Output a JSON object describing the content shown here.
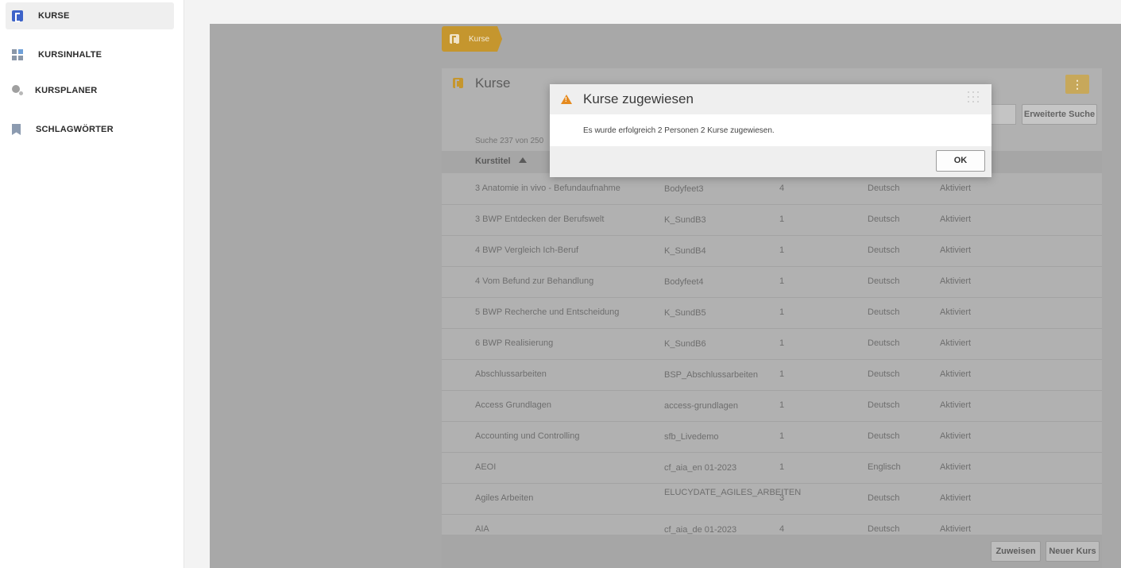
{
  "sidebar": {
    "items": [
      {
        "label": "KURSE",
        "icon": "kurse-icon",
        "active": true
      },
      {
        "label": "KURSINHALTE",
        "icon": "kursinhalte-icon"
      },
      {
        "label": "KURSPLANER",
        "icon": "kursplaner-icon"
      },
      {
        "label": "SCHLAGWÖRTER",
        "icon": "bookmark-icon"
      }
    ]
  },
  "breadcrumb": {
    "label": "Kurse"
  },
  "panel": {
    "title": "Kurse",
    "advanced_search_label": "Erweiterte Suche",
    "result_count": "Suche 237 von 250",
    "column_header": "Kurstitel"
  },
  "table": {
    "rows": [
      [
        "3 Anatomie in vivo - Befundaufnahme",
        "Bodyfeet3",
        "4",
        "Deutsch",
        "Aktiviert"
      ],
      [
        "3 BWP Entdecken der Berufswelt",
        "K_SundB3",
        "1",
        "Deutsch",
        "Aktiviert"
      ],
      [
        "4 BWP Vergleich Ich-Beruf",
        "K_SundB4",
        "1",
        "Deutsch",
        "Aktiviert"
      ],
      [
        "4 Vom Befund zur Behandlung",
        "Bodyfeet4",
        "1",
        "Deutsch",
        "Aktiviert"
      ],
      [
        "5 BWP Recherche und Entscheidung",
        "K_SundB5",
        "1",
        "Deutsch",
        "Aktiviert"
      ],
      [
        "6 BWP Realisierung",
        "K_SundB6",
        "1",
        "Deutsch",
        "Aktiviert"
      ],
      [
        "Abschlussarbeiten",
        "BSP_Abschlussarbeiten",
        "1",
        "Deutsch",
        "Aktiviert"
      ],
      [
        "Access Grundlagen",
        "access-grundlagen",
        "1",
        "Deutsch",
        "Aktiviert"
      ],
      [
        "Accounting und Controlling",
        "sfb_Livedemo",
        "1",
        "Deutsch",
        "Aktiviert"
      ],
      [
        "AEOI",
        "cf_aia_en 01-2023",
        "1",
        "Englisch",
        "Aktiviert"
      ],
      [
        "Agiles Arbeiten",
        "ELUCYDATE_AGILES_ARBEITEN",
        "3",
        "Deutsch",
        "Aktiviert"
      ],
      [
        "AIA",
        "cf_aia_de 01-2023",
        "4",
        "Deutsch",
        "Aktiviert"
      ]
    ]
  },
  "footer": {
    "assign_label": "Zuweisen",
    "new_course_label": "Neuer Kurs"
  },
  "modal": {
    "title": "Kurse zugewiesen",
    "message": "Es wurde erfolgreich 2 Personen 2 Kurse zugewiesen.",
    "ok_label": "OK",
    "icon": "warning-icon"
  },
  "colors": {
    "accent": "#c5962e",
    "primary": "#3d63c9",
    "warning": "#e58a1f"
  }
}
